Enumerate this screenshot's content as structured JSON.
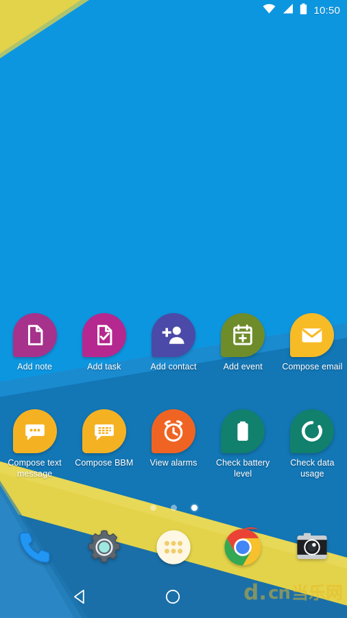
{
  "status_bar": {
    "time": "10:50",
    "icons": [
      "wifi-icon",
      "cellular-signal-icon",
      "battery-icon"
    ]
  },
  "colors": {
    "wallpaper_blue": "#0d96e0",
    "wallpaper_blue_dark": "#1376b5",
    "wallpaper_blue_deep": "#1a6fa8",
    "wallpaper_yellow": "#e3d34a",
    "label_text": "#ffffff",
    "watermark": "#e8b923"
  },
  "home_screen": {
    "rows": [
      {
        "items": [
          {
            "label": "Add note",
            "icon": "note-document-icon",
            "tile_color": "#a6328c"
          },
          {
            "label": "Add task",
            "icon": "task-checkmark-icon",
            "tile_color": "#b5288f"
          },
          {
            "label": "Add contact",
            "icon": "add-person-icon",
            "tile_color": "#4b4aa8"
          },
          {
            "label": "Add event",
            "icon": "calendar-plus-icon",
            "tile_color": "#6e8c2a"
          },
          {
            "label": "Compose email",
            "icon": "envelope-icon",
            "tile_color": "#f7bb25"
          }
        ]
      },
      {
        "items": [
          {
            "label": "Compose text message",
            "icon": "chat-bubble-dots-icon",
            "tile_color": "#f4b223"
          },
          {
            "label": "Compose BBM",
            "icon": "bbm-chat-bubble-icon",
            "tile_color": "#f4b223"
          },
          {
            "label": "View alarms",
            "icon": "alarm-clock-icon",
            "tile_color": "#f06423"
          },
          {
            "label": "Check battery level",
            "icon": "battery-full-icon",
            "tile_color": "#11806d"
          },
          {
            "label": "Check data usage",
            "icon": "data-usage-donut-icon",
            "tile_color": "#11806d"
          }
        ]
      }
    ],
    "page_indicator": {
      "total": 3,
      "current": 3
    }
  },
  "dock": {
    "items": [
      {
        "name": "phone-icon",
        "label": "Phone"
      },
      {
        "name": "settings-gear-icon",
        "label": "Settings"
      },
      {
        "name": "app-drawer-icon",
        "label": "All apps"
      },
      {
        "name": "chrome-icon",
        "label": "Chrome"
      },
      {
        "name": "camera-icon",
        "label": "Camera"
      }
    ]
  },
  "navigation_bar": {
    "back": "back-triangle-icon",
    "home": "home-circle-icon",
    "watermark": {
      "d": "d.",
      "cn": "cn",
      "han": "当乐网"
    }
  }
}
